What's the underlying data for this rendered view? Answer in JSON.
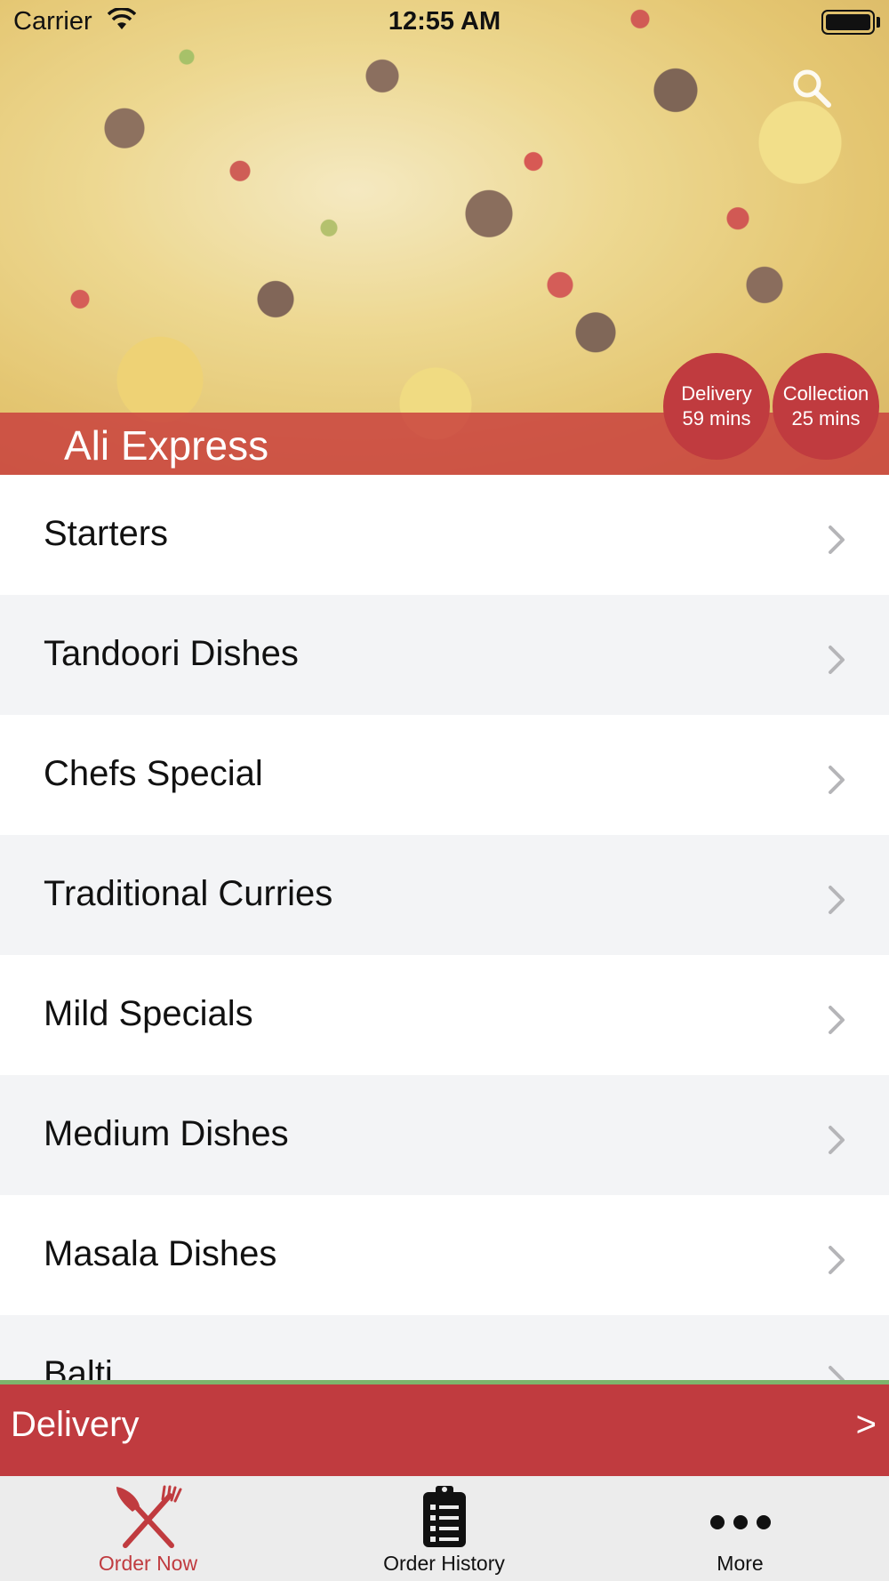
{
  "status_bar": {
    "carrier": "Carrier",
    "time": "12:55 AM"
  },
  "header": {
    "restaurant_name": "Ali Express",
    "search_icon": "search-icon",
    "delivery_badge": {
      "label": "Delivery",
      "time": "59 mins"
    },
    "collection_badge": {
      "label": "Collection",
      "time": "25 mins"
    }
  },
  "menu": {
    "items": [
      {
        "label": "Starters"
      },
      {
        "label": "Tandoori Dishes"
      },
      {
        "label": "Chefs Special"
      },
      {
        "label": "Traditional Curries"
      },
      {
        "label": "Mild Specials"
      },
      {
        "label": "Medium Dishes"
      },
      {
        "label": "Masala Dishes"
      },
      {
        "label": "Balti"
      }
    ]
  },
  "order_mode_bar": {
    "label": "Delivery",
    "arrow": ">"
  },
  "tab_bar": {
    "tabs": [
      {
        "label": "Order Now",
        "icon": "fork-knife-icon",
        "active": true
      },
      {
        "label": "Order History",
        "icon": "clipboard-icon",
        "active": false
      },
      {
        "label": "More",
        "icon": "more-dots-icon",
        "active": false
      }
    ]
  },
  "colors": {
    "brand_red": "#c03b3f",
    "accent_green": "#7db56c",
    "row_alt": "#f3f4f6",
    "tab_bar_bg": "#ececec"
  }
}
